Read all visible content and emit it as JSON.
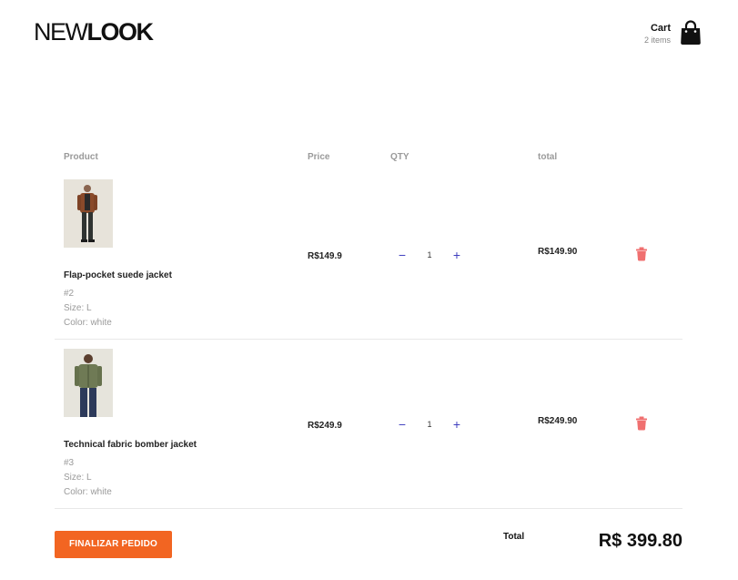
{
  "header": {
    "logo_part1": "NEW",
    "logo_part2": "LOOK",
    "cart_title": "Cart",
    "cart_count": "2 items"
  },
  "table": {
    "headers": {
      "product": "Product",
      "price": "Price",
      "qty": "QTY",
      "total": "total"
    },
    "items": [
      {
        "name": "Flap-pocket suede jacket",
        "sku": "#2",
        "size": "Size: L",
        "color": "Color: white",
        "price": "R$149.9",
        "qty": "1",
        "total": "R$149.90",
        "minus": "−",
        "plus": "+"
      },
      {
        "name": "Technical fabric bomber jacket",
        "sku": "#3",
        "size": "Size: L",
        "color": "Color: white",
        "price": "R$249.9",
        "qty": "1",
        "total": "R$249.90",
        "minus": "−",
        "plus": "+"
      }
    ]
  },
  "footer": {
    "checkout_label": "FINALIZAR PEDIDO",
    "total_label": "Total",
    "total_value": "R$ 399.80"
  },
  "icons": {
    "cart": "shopping-bag-icon",
    "delete": "trash-icon"
  },
  "colors": {
    "accent": "#f26522",
    "qty_controls": "#3f3fbf",
    "delete": "#f07070",
    "muted_text": "#9a9a9a"
  }
}
